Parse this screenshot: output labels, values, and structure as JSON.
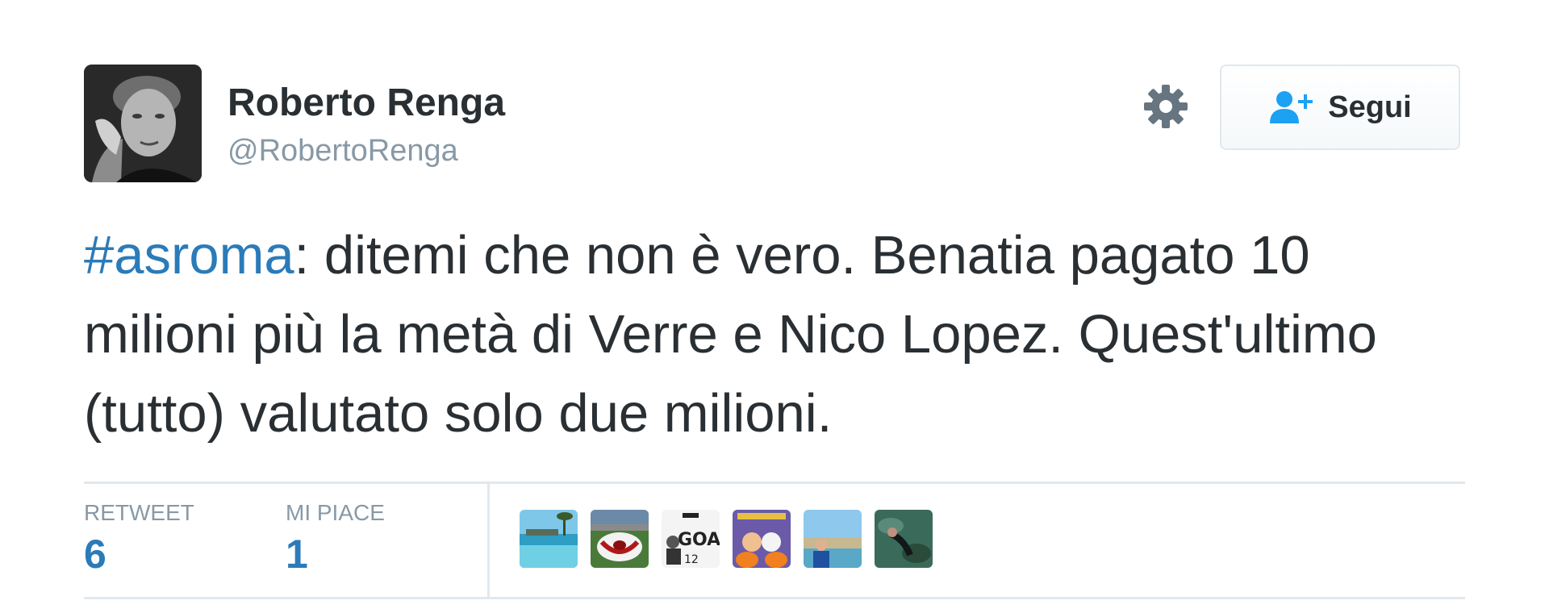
{
  "user": {
    "name": "Roberto Renga",
    "handle": "@RobertoRenga"
  },
  "follow_button": {
    "label": "Segui",
    "icon": "add-user-icon"
  },
  "settings": {
    "icon": "gear-icon"
  },
  "tweet": {
    "hashtag": "#asroma",
    "text": ": ditemi che non è vero. Benatia pagato 10 milioni più la metà di Verre e Nico Lopez. Quest'ultimo (tutto) valutato solo due milioni."
  },
  "stats": {
    "retweet_label": "RETWEET",
    "retweet_count": "6",
    "likes_label": "MI PIACE",
    "likes_count": "1"
  },
  "colors": {
    "text": "#292f33",
    "secondary": "#8899a6",
    "link": "#2b7bb9",
    "follow_icon": "#1da1f2",
    "divider": "#e1e8ed",
    "gear": "#66757f"
  }
}
